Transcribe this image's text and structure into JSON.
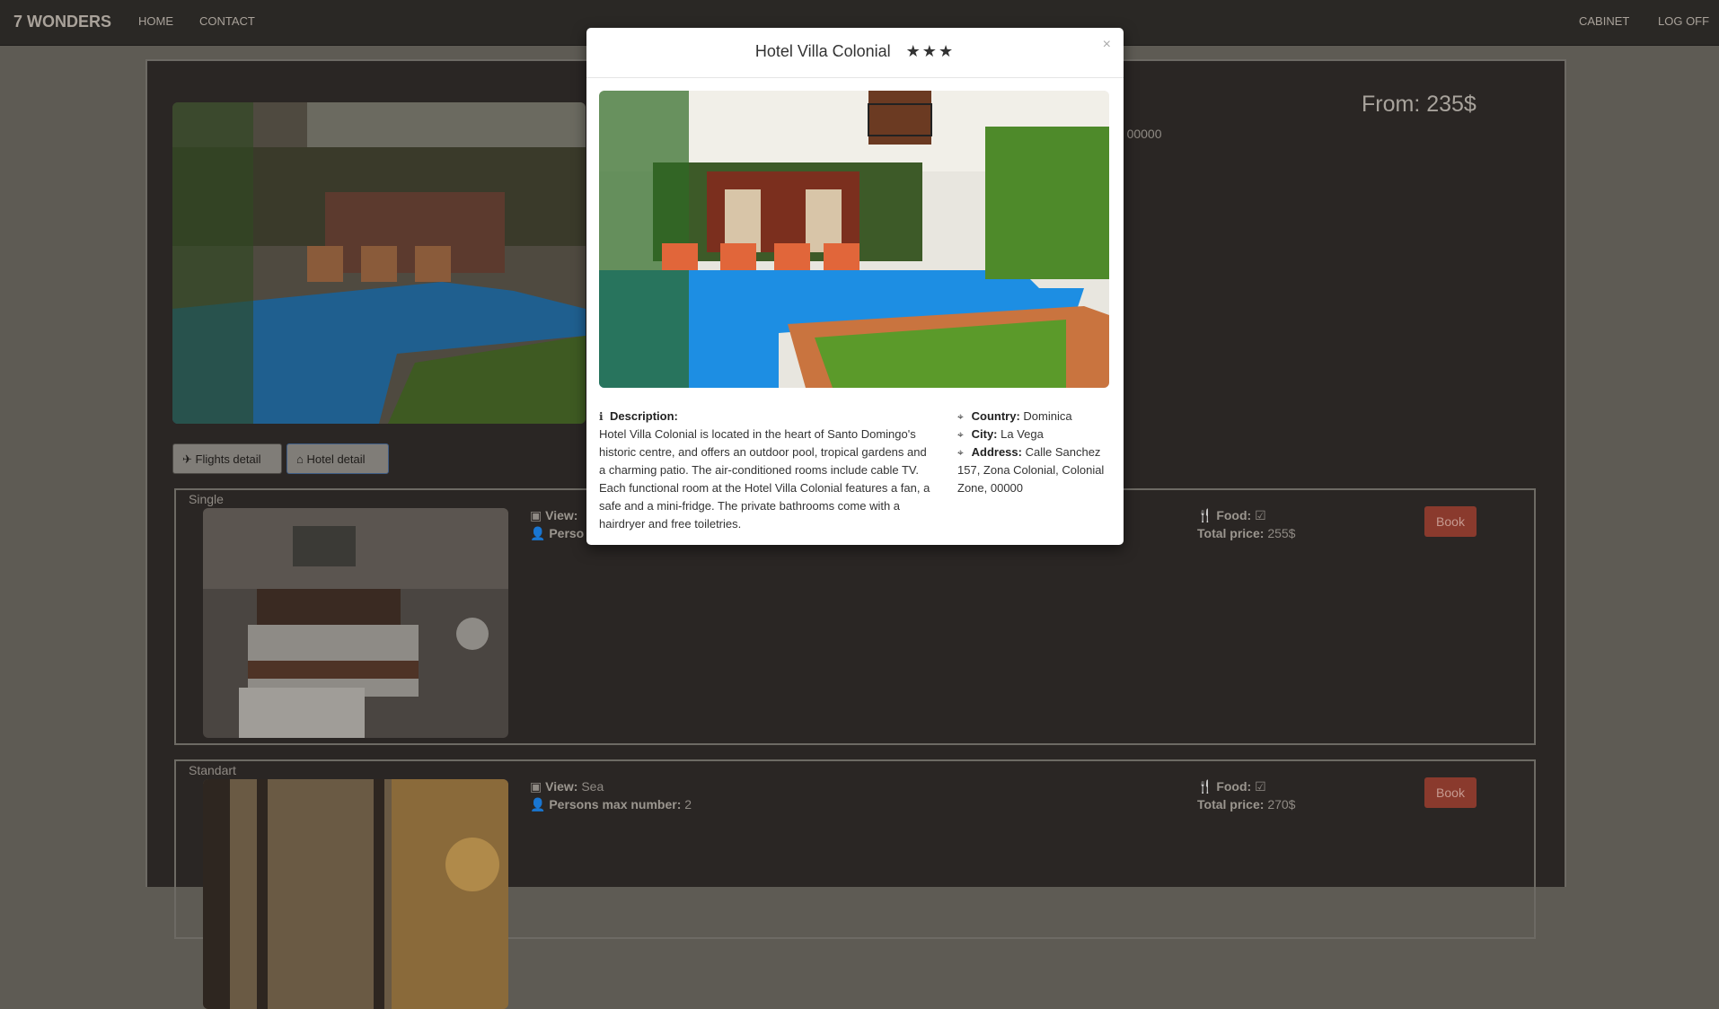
{
  "navbar": {
    "brand": "7 WONDERS",
    "home": "HOME",
    "contact": "CONTACT",
    "cabinet": "CABINET",
    "logoff": "LOG OFF"
  },
  "hotel": {
    "price": "From: 235$",
    "address_tail": "e, 00000"
  },
  "buttons": {
    "flights": "Flights detail",
    "hotel": "Hotel detail"
  },
  "rooms": [
    {
      "title": "Single",
      "view_label": "View:",
      "view": "",
      "persons_label": "Perso",
      "persons": "",
      "food_label": "Food:",
      "food_check": "☑",
      "total_label": "Total price:",
      "total": "255$",
      "book": "Book"
    },
    {
      "title": "Standart",
      "view_label": "View:",
      "view": "Sea",
      "persons_label": "Persons max number:",
      "persons": "2",
      "food_label": "Food:",
      "food_check": "☑",
      "total_label": "Total price:",
      "total": "270$",
      "book": "Book"
    }
  ],
  "modal": {
    "title": "Hotel Villa Colonial",
    "stars": "★★★",
    "close": "×",
    "description_label": "Description:",
    "description": "Hotel Villa Colonial is located in the heart of Santo Domingo's historic centre, and offers an outdoor pool, tropical gardens and a charming patio. The air-conditioned rooms include cable TV. Each functional room at the Hotel Villa Colonial features a fan, a safe and a mini-fridge. The private bathrooms come with a hairdryer and free toiletries.",
    "country_label": "Country:",
    "country": "Dominica",
    "city_label": "City:",
    "city": "La Vega",
    "address_label": "Address:",
    "address": "Calle Sanchez 157, Zona Colonial, Colonial Zone, 00000"
  },
  "icons": {
    "plane": "plane-icon",
    "home": "home-icon",
    "picture": "picture-icon",
    "user": "user-icon",
    "cutlery": "cutlery-icon",
    "info": "info-icon",
    "map_marker": "map-marker-icon"
  }
}
